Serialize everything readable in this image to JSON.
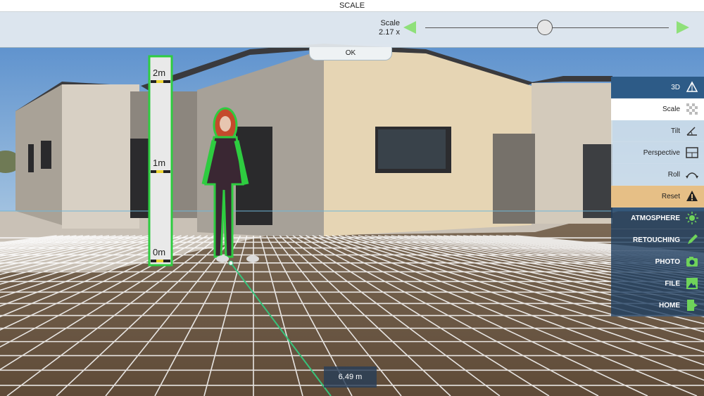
{
  "header": {
    "title": "SCALE"
  },
  "scale_control": {
    "label": "Scale",
    "value": "2.17 x",
    "slider_position": 0.49,
    "decrease_icon": "triangle-left-icon",
    "increase_icon": "triangle-right-icon",
    "arrow_color": "#8fe07a"
  },
  "ok_button": {
    "label": "OK"
  },
  "measuring_pole": {
    "marks": [
      "2m",
      "1m",
      "0m"
    ],
    "outline_color": "#2ecc40"
  },
  "distance_readout": {
    "text": "6.49 m"
  },
  "tool_panel": {
    "items": [
      {
        "label": "3D",
        "icon": "3d-axes-icon",
        "state": "primary"
      },
      {
        "label": "Scale",
        "icon": "scale-checker-icon",
        "state": "active"
      },
      {
        "label": "Tilt",
        "icon": "tilt-icon",
        "state": "normal"
      },
      {
        "label": "Perspective",
        "icon": "perspective-grid-icon",
        "state": "normal"
      },
      {
        "label": "Roll",
        "icon": "roll-icon",
        "state": "normal"
      },
      {
        "label": "Reset",
        "icon": "warning-icon",
        "state": "warning"
      },
      {
        "label": "ATMOSPHERE",
        "icon": "sun-icon",
        "state": "menu"
      },
      {
        "label": "RETOUCHING",
        "icon": "pencil-icon",
        "state": "menu"
      },
      {
        "label": "PHOTO",
        "icon": "camera-icon",
        "state": "menu"
      },
      {
        "label": "FILE",
        "icon": "image-file-icon",
        "state": "menu"
      },
      {
        "label": "HOME",
        "icon": "door-exit-icon",
        "state": "menu"
      }
    ],
    "accent_green": "#4caf50",
    "primary_blue": "#2d5b87",
    "warning_color": "#e6bf86"
  }
}
